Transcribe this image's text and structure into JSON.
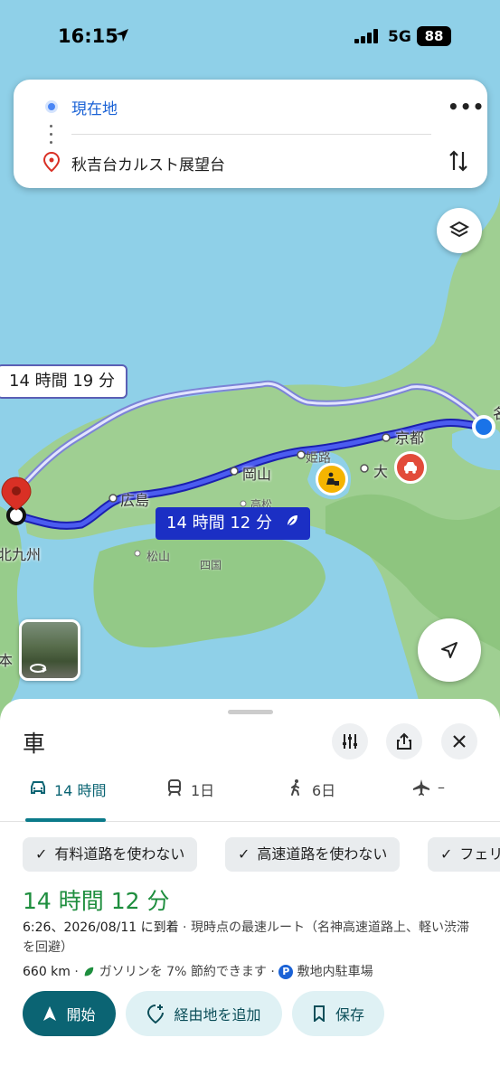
{
  "status": {
    "time": "16:15",
    "network": "5G",
    "battery": "88"
  },
  "search": {
    "origin": "現在地",
    "destination": "秋吉台カルスト展望台"
  },
  "map": {
    "alt_route_label": "14 時間 19 分",
    "main_route_label": "14 時間 12 分",
    "cities": {
      "kyoto": "京都",
      "hiroshima": "広島",
      "okayama": "岡山",
      "himeji": "姫路",
      "osaka": "大",
      "kitakyushu": "北九州",
      "matsuyama": "松山",
      "shikoku": "四国",
      "takamatsu": "高松",
      "nagoya_partial": "名",
      "kumamoto_partial": "本"
    }
  },
  "sheet": {
    "mode_title": "車",
    "tabs": [
      {
        "label": "14 時間",
        "icon": "car-icon"
      },
      {
        "label": "1日",
        "icon": "train-icon"
      },
      {
        "label": "6日",
        "icon": "walk-icon"
      },
      {
        "label": "–",
        "icon": "plane-icon"
      }
    ],
    "chips": [
      "有料道路を使わない",
      "高速道路を使わない",
      "フェリ"
    ],
    "duration": "14 時間 12 分",
    "arrival": "6:26、2026/08/11 に到着",
    "route_desc": " · 現時点の最速ルート（名神高速道路上、軽い渋滞を回避）",
    "distance": "660 km",
    "fuel": "ガソリンを 7% 節約できます",
    "parking": "敷地内駐車場",
    "buttons": {
      "start": "開始",
      "add_stop": "経由地を追加",
      "save": "保存"
    }
  },
  "colors": {
    "accent": "#0b6473",
    "route": "#1b2fc4",
    "duration_green": "#1e8e3e"
  }
}
